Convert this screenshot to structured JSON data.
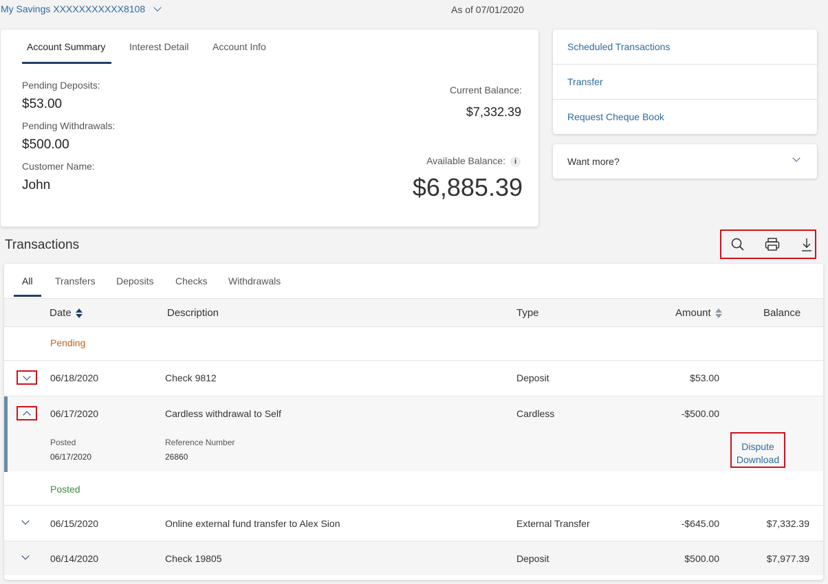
{
  "header": {
    "account_selector": "My Savings XXXXXXXXXXX8108",
    "as_of": "As of 07/01/2020"
  },
  "summary": {
    "tabs": [
      "Account Summary",
      "Interest Detail",
      "Account Info"
    ],
    "active_tab": "Account Summary",
    "pending_deposits_label": "Pending Deposits:",
    "pending_deposits_value": "$53.00",
    "pending_withdrawals_label": "Pending Withdrawals:",
    "pending_withdrawals_value": "$500.00",
    "customer_name_label": "Customer Name:",
    "customer_name_value": "John",
    "current_balance_label": "Current Balance:",
    "current_balance_value": "$7,332.39",
    "available_balance_label": "Available Balance:",
    "available_balance_value": "$6,885.39",
    "info_icon": "i"
  },
  "quick_links": {
    "items": [
      "Scheduled Transactions",
      "Transfer",
      "Request Cheque Book"
    ],
    "want_more": "Want more?"
  },
  "transactions": {
    "title": "Transactions",
    "toolbar_icons": [
      "search-icon",
      "print-icon",
      "download-icon"
    ],
    "tabs": [
      "All",
      "Transfers",
      "Deposits",
      "Checks",
      "Withdrawals"
    ],
    "active_tab": "All",
    "columns": {
      "date": "Date",
      "description": "Description",
      "type": "Type",
      "amount": "Amount",
      "balance": "Balance"
    },
    "pending_label": "Pending",
    "posted_label": "Posted",
    "pending_rows": [
      {
        "date": "06/18/2020",
        "description": "Check 9812",
        "type": "Deposit",
        "amount": "$53.00",
        "balance": ""
      },
      {
        "date": "06/17/2020",
        "description": "Cardless withdrawal to Self",
        "type": "Cardless",
        "amount": "-$500.00",
        "balance": ""
      }
    ],
    "expanded_detail": {
      "posted_label": "Posted",
      "posted_value": "06/17/2020",
      "reference_label": "Reference Number",
      "reference_value": "26860",
      "dispute": "Dispute",
      "download": "Download"
    },
    "posted_rows": [
      {
        "date": "06/15/2020",
        "description": "Online external fund transfer to Alex Sion",
        "type": "External Transfer",
        "amount": "-$645.00",
        "balance": "$7,332.39"
      },
      {
        "date": "06/14/2020",
        "description": "Check 19805",
        "type": "Deposit",
        "amount": "$500.00",
        "balance": "$7,977.39"
      }
    ]
  },
  "colors": {
    "link": "#2e6a9e",
    "navy": "#1f3f66",
    "highlight_box": "#d0121b",
    "pending": "#c0651c",
    "posted": "#3f8a3a"
  }
}
